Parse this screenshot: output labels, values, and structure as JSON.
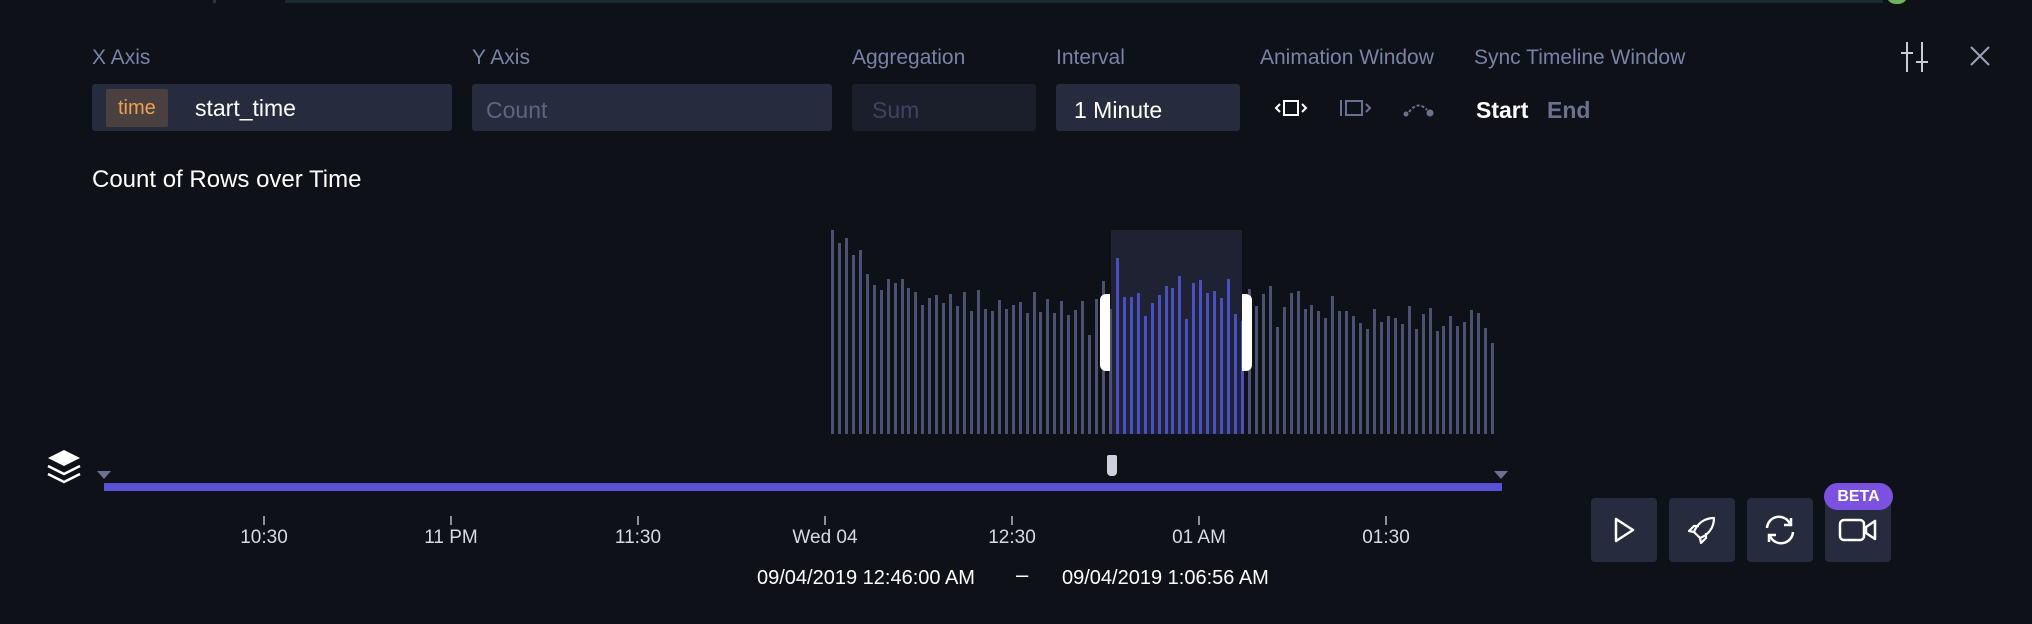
{
  "fields": {
    "x_axis": {
      "label": "X Axis",
      "tag": "time",
      "value": "start_time"
    },
    "y_axis": {
      "label": "Y Axis",
      "placeholder": "Count"
    },
    "aggregation": {
      "label": "Aggregation",
      "placeholder": "Sum"
    },
    "interval": {
      "label": "Interval",
      "value": "1 Minute"
    },
    "animation_window": {
      "label": "Animation Window",
      "options": [
        "free-icon",
        "incremental-icon",
        "point-icon"
      ]
    },
    "sync": {
      "label": "Sync Timeline Window",
      "start": "Start",
      "end": "End"
    }
  },
  "chart_title": "Count of Rows over Time",
  "chart_data": {
    "type": "bar",
    "x_ticks": [
      "10:30",
      "11 PM",
      "11:30",
      "Wed 04",
      "12:30",
      "01 AM",
      "01:30"
    ],
    "values": [
      200,
      187,
      192,
      176,
      180,
      157,
      146,
      141,
      152,
      148,
      152,
      143,
      139,
      127,
      133,
      136,
      128,
      137,
      126,
      139,
      121,
      141,
      123,
      121,
      131,
      123,
      127,
      129,
      119,
      139,
      120,
      132,
      119,
      130,
      117,
      122,
      130,
      97,
      132,
      150,
      123,
      173,
      134,
      134,
      138,
      116,
      128,
      136,
      145,
      143,
      155,
      113,
      148,
      151,
      138,
      140,
      133,
      152,
      118,
      111,
      142,
      126,
      137,
      145,
      105,
      125,
      138,
      140,
      123,
      127,
      121,
      114,
      135,
      121,
      121,
      116,
      109,
      103,
      123,
      110,
      116,
      114,
      108,
      126,
      103,
      118,
      124,
      101,
      106,
      116,
      106,
      110,
      122,
      119,
      104,
      89
    ],
    "selected_range_index": [
      41,
      59
    ],
    "colors": {
      "bars": "#4b5170",
      "selected_bars": "#4a4fc0",
      "track": "#5a52d5"
    }
  },
  "time_range": {
    "start": "09/04/2019 12:46:00 AM",
    "separator": "–",
    "end": "09/04/2019 1:06:56 AM"
  },
  "controls": {
    "beta_badge": "BETA",
    "buttons": [
      "play-icon",
      "rocket-icon",
      "loop-icon",
      "video-icon"
    ]
  }
}
